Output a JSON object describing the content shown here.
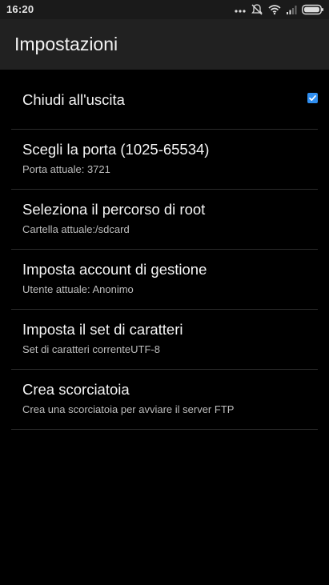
{
  "status_bar": {
    "time": "16:20",
    "icons": [
      "dots-icon",
      "mute-icon",
      "wifi-icon",
      "signal-icon",
      "battery-icon"
    ]
  },
  "app_bar": {
    "title": "Impostazioni"
  },
  "settings": [
    {
      "title": "Chiudi all'uscita",
      "subtitle": "",
      "checked": true
    },
    {
      "title": "Scegli la porta (1025-65534)",
      "subtitle": "Porta attuale: 3721"
    },
    {
      "title": "Seleziona il percorso di root",
      "subtitle": "Cartella attuale:/sdcard"
    },
    {
      "title": "Imposta account di gestione",
      "subtitle": "Utente attuale: Anonimo"
    },
    {
      "title": "Imposta il set di caratteri",
      "subtitle": "Set di caratteri correnteUTF-8"
    },
    {
      "title": "Crea scorciatoia",
      "subtitle": "Crea una scorciatoia per avviare il server FTP"
    }
  ],
  "colors": {
    "background": "#000000",
    "app_bar": "#212121",
    "status_bar": "#1a1a1a",
    "checkbox_accent": "#2f8ef0",
    "divider": "#2b2b2b"
  }
}
